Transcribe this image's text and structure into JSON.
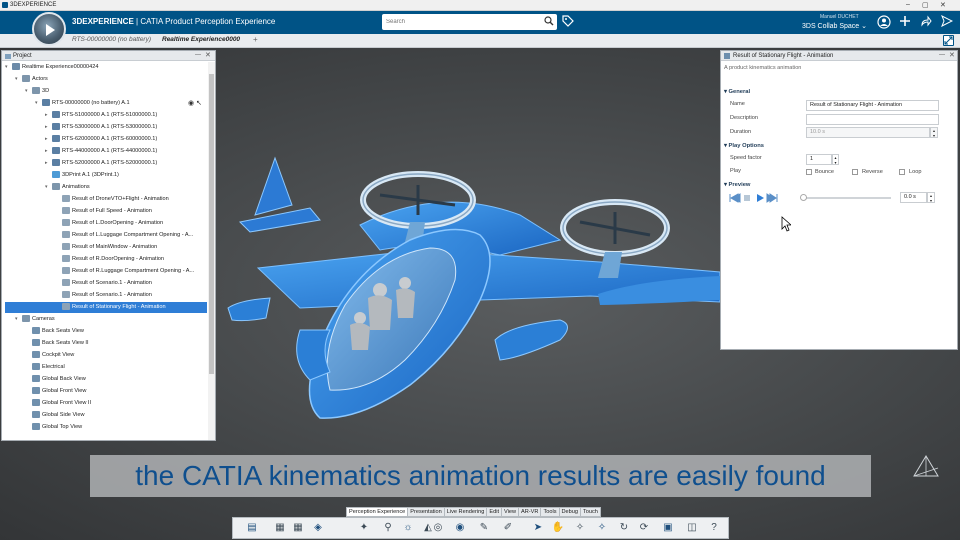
{
  "window": {
    "title": "3DEXPERIENCE",
    "controls": [
      "–",
      "▢",
      "✕"
    ]
  },
  "app": {
    "brand_bold": "3DEXPERIENCE",
    "brand_rest": " | CATIA  Product Perception Experience",
    "search_placeholder": "Search",
    "user_name": "Manuel DUCHET",
    "collab_space": "3DS Collab Space ⌄"
  },
  "tabs": [
    {
      "label": "RTS-00000000 (no battery)"
    },
    {
      "label": "Realtime Experience0000"
    }
  ],
  "tab_add": "+",
  "tree": {
    "panel_title": "Project",
    "rows": [
      {
        "label": "Realtime Experience00000424",
        "depth": 0,
        "kind": "root"
      },
      {
        "label": "Actors",
        "depth": 1,
        "kind": "folder"
      },
      {
        "label": "3D",
        "depth": 2,
        "kind": "folder"
      },
      {
        "label": "RTS-00000000 (no battery) A.1",
        "depth": 3,
        "kind": "product"
      },
      {
        "label": "RTS-51000000 A.1 (RTS-51000000.1)",
        "depth": 4,
        "kind": "product"
      },
      {
        "label": "RTS-53000000 A.1 (RTS-53000000.1)",
        "depth": 4,
        "kind": "product"
      },
      {
        "label": "RTS-62000000 A.1 (RTS-60000000.1)",
        "depth": 4,
        "kind": "product"
      },
      {
        "label": "RTS-44000000 A.1 (RTS-44000000.1)",
        "depth": 4,
        "kind": "product"
      },
      {
        "label": "RTS-52000000 A.1 (RTS-52000000.1)",
        "depth": 4,
        "kind": "product"
      },
      {
        "label": "3DPrint A.1 (3DPrint.1)",
        "depth": 4,
        "kind": "print"
      },
      {
        "label": "Animations",
        "depth": 4,
        "kind": "folder"
      },
      {
        "label": "Result of DroneVTO+Flight - Animation",
        "depth": 5,
        "kind": "anim"
      },
      {
        "label": "Result of Full Speed - Animation",
        "depth": 5,
        "kind": "anim"
      },
      {
        "label": "Result of L.DoorOpening - Animation",
        "depth": 5,
        "kind": "anim"
      },
      {
        "label": "Result of L.Luggage Compartment Opening - A...",
        "depth": 5,
        "kind": "anim"
      },
      {
        "label": "Result of MainWindow - Animation",
        "depth": 5,
        "kind": "anim"
      },
      {
        "label": "Result of R.DoorOpening - Animation",
        "depth": 5,
        "kind": "anim"
      },
      {
        "label": "Result of R.Luggage Compartment Opening - A...",
        "depth": 5,
        "kind": "anim"
      },
      {
        "label": "Result of Scenario.1 - Animation",
        "depth": 5,
        "kind": "anim"
      },
      {
        "label": "Result of Scenario.1 - Animation",
        "depth": 5,
        "kind": "anim"
      },
      {
        "label": "Result of Stationary Flight - Animation",
        "depth": 5,
        "kind": "anim",
        "selected": true
      },
      {
        "label": "Cameras",
        "depth": 1,
        "kind": "folder"
      },
      {
        "label": "Back Seats View",
        "depth": 2,
        "kind": "camera"
      },
      {
        "label": "Back Seats View II",
        "depth": 2,
        "kind": "camera"
      },
      {
        "label": "Cockpit View",
        "depth": 2,
        "kind": "camera"
      },
      {
        "label": "Electrical",
        "depth": 2,
        "kind": "camera"
      },
      {
        "label": "Global Back View",
        "depth": 2,
        "kind": "camera"
      },
      {
        "label": "Global Front View",
        "depth": 2,
        "kind": "camera"
      },
      {
        "label": "Global Front View II",
        "depth": 2,
        "kind": "camera"
      },
      {
        "label": "Global Side View",
        "depth": 2,
        "kind": "camera"
      },
      {
        "label": "Global Top View",
        "depth": 2,
        "kind": "camera"
      }
    ]
  },
  "props": {
    "panel_title": "Result of Stationary Flight - Animation",
    "subtitle": "A product kinematics animation",
    "general": {
      "header": "General",
      "name_label": "Name",
      "name_value": "Result of Stationary Flight - Animation",
      "description_label": "Description",
      "description_value": "",
      "duration_label": "Duration",
      "duration_value": "10.0 s"
    },
    "play_options": {
      "header": "Play Options",
      "speed_label": "Speed factor",
      "speed_value": "1",
      "play_label": "Play",
      "bounce": "Bounce",
      "reverse": "Reverse",
      "loop": "Loop"
    },
    "preview": {
      "header": "Preview",
      "time_value": "0.0 s"
    }
  },
  "subtitle_text": "the CATIA kinematics animation results are easily found",
  "bottom_tabs": [
    "Perception Experience",
    "Presentation",
    "Live Rendering",
    "Edit",
    "View",
    "AR-VR",
    "Tools",
    "Debug",
    "Touch"
  ],
  "toolbar_icons": [
    "tree-toggle-icon",
    "scene-icon",
    "scene-2-icon",
    "material-icon",
    "light-icon",
    "walk-icon",
    "sun-icon",
    "environment-icon",
    "camera-icon",
    "render-icon",
    "ruler-icon",
    "pen-icon",
    "arrow-icon",
    "hand-icon",
    "sparkle-icon",
    "sparkle-2-icon",
    "loop-icon",
    "sync-icon",
    "video-icon",
    "capture-icon",
    "help-icon"
  ],
  "colors": {
    "accent": "#005386",
    "selection": "#2f7ed6",
    "aircraft": "#2b7fd6",
    "subtitle_text": "#0f4f8e"
  }
}
